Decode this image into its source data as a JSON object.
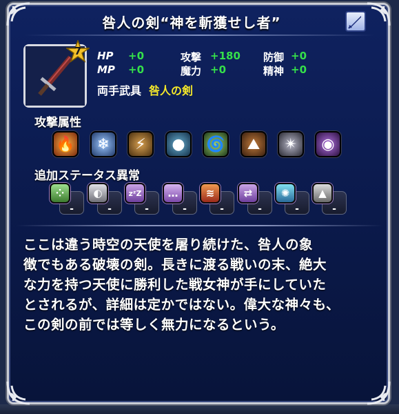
{
  "title": "咎人の剣“神を斬獲せし者”",
  "category_icon": "sword-category-icon",
  "rarity_star": "7",
  "stats": {
    "hp": {
      "label": "HP",
      "value": "+0"
    },
    "mp": {
      "label": "MP",
      "value": "+0"
    },
    "attack": {
      "label": "攻撃",
      "value": "+180"
    },
    "magic": {
      "label": "魔力",
      "value": "+0"
    },
    "defense": {
      "label": "防御",
      "value": "+0"
    },
    "spirit": {
      "label": "精神",
      "value": "+0"
    }
  },
  "weapon_type": "両手武具",
  "weapon_name": "咎人の剣",
  "attack_attribute_label": "攻撃属性",
  "elements": [
    {
      "icon": "fire-icon",
      "bg": "#c2481c"
    },
    {
      "icon": "ice-icon",
      "bg": "#5a86c9"
    },
    {
      "icon": "lightning-icon",
      "bg": "#8a6a2a"
    },
    {
      "icon": "water-icon",
      "bg": "#2a5a7a"
    },
    {
      "icon": "wind-icon",
      "bg": "#3c6a3a"
    },
    {
      "icon": "earth-icon",
      "bg": "#7a4a22"
    },
    {
      "icon": "holy-icon",
      "bg": "#5c5c66"
    },
    {
      "icon": "dark-icon",
      "bg": "#5a2a7a"
    }
  ],
  "status_label": "追加ステータス異常",
  "statuses": [
    {
      "icon": "poison-icon",
      "value": "-"
    },
    {
      "icon": "blind-icon",
      "value": "-"
    },
    {
      "icon": "sleep-icon",
      "value": "-"
    },
    {
      "icon": "silence-icon",
      "value": "-"
    },
    {
      "icon": "paralyze-icon",
      "value": "-"
    },
    {
      "icon": "confuse-icon",
      "value": "-"
    },
    {
      "icon": "disease-icon",
      "value": "-"
    },
    {
      "icon": "petrify-icon",
      "value": "-"
    }
  ],
  "description_lines": [
    "ここは違う時空の天使を屠り続けた、咎人の象",
    "徴でもある破壊の剣。長きに渡る戦いの末、絶大",
    "な力を持つ天使に勝利した戦女神が手にしていた",
    "とされるが、詳細は定かではない。偉大な神々も、",
    "この剣の前では等しく無力になるという。"
  ]
}
